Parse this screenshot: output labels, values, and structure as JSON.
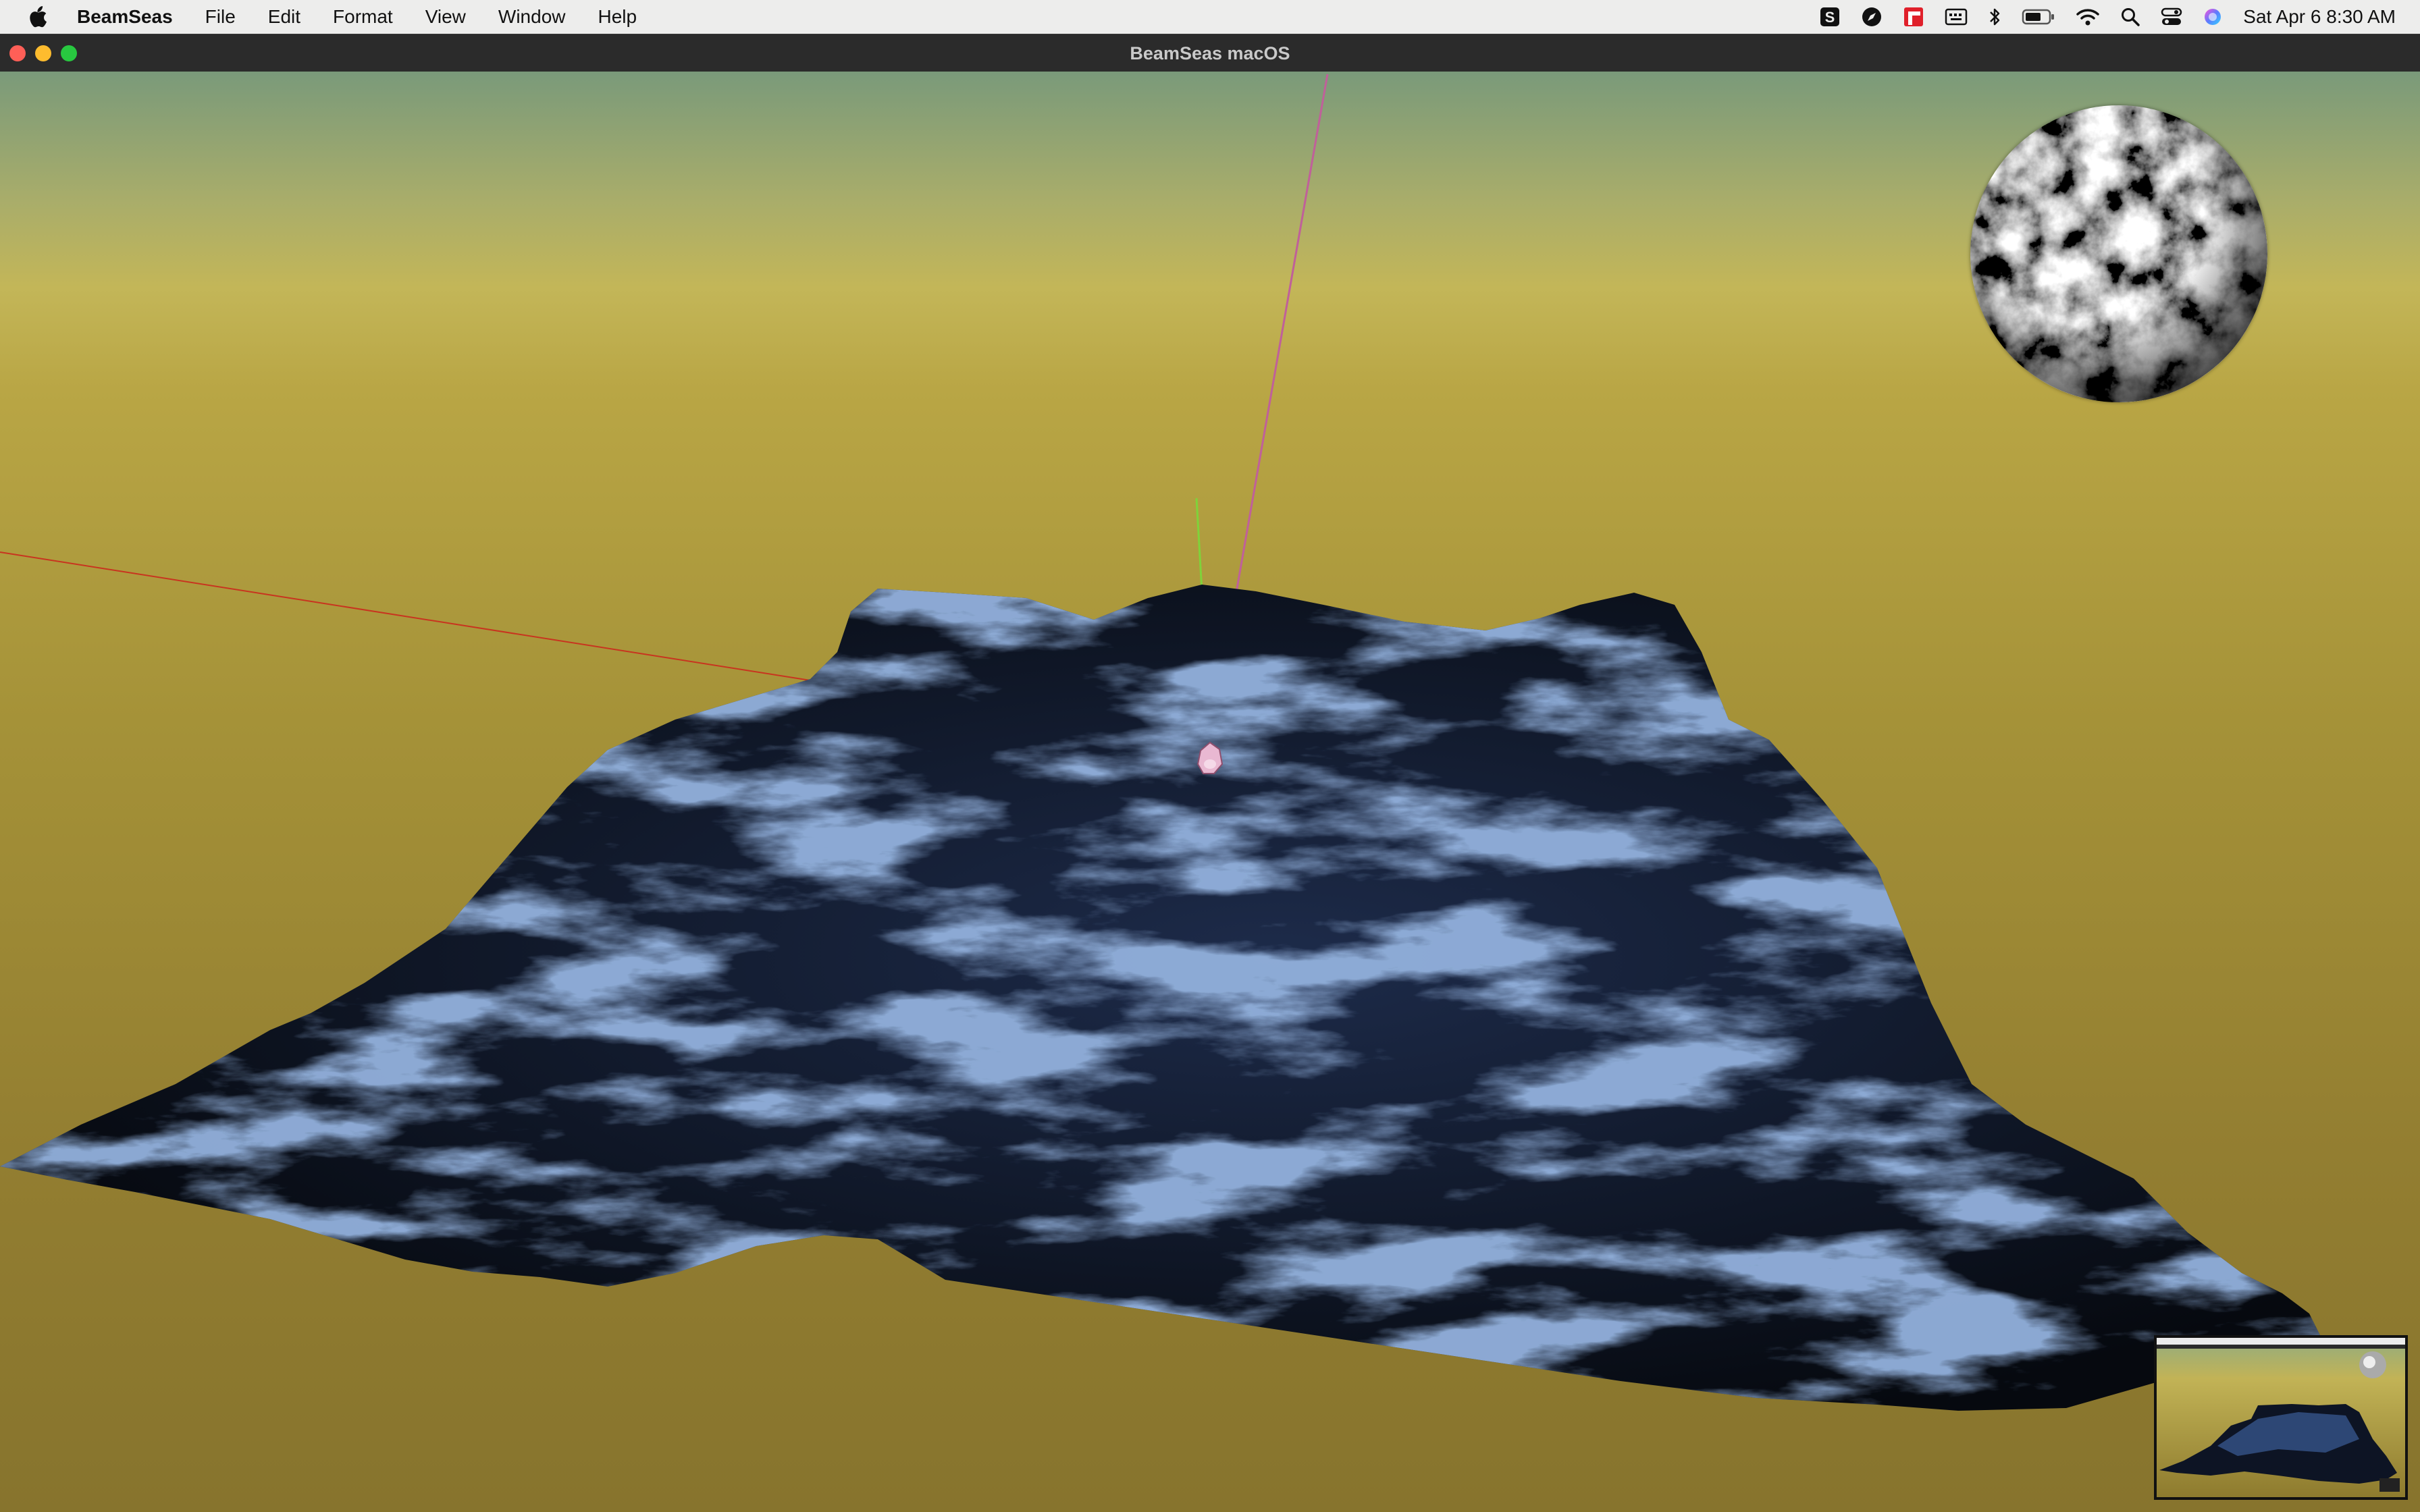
{
  "menubar": {
    "app_name": "BeamSeas",
    "items": [
      "File",
      "Edit",
      "Format",
      "View",
      "Window",
      "Help"
    ],
    "clock": "Sat Apr 6  8:30 AM"
  },
  "window": {
    "title": "BeamSeas macOS"
  },
  "colors": {
    "sky_top": "#7d9a78",
    "sky_horizon": "#c2b356",
    "ground": "#8c7a2c",
    "water_highlight": "#4a6fb0",
    "water_shadow": "#0a0f1a",
    "axis_x": "#d02a1c",
    "axis_y": "#7fd33a",
    "axis_z": "#c0609a"
  },
  "icons": [
    "apple-icon",
    "s-badge-icon",
    "compass-icon",
    "parallels-icon",
    "keyboard-icon",
    "bluetooth-icon",
    "battery-icon",
    "wifi-icon",
    "search-icon",
    "control-center-icon",
    "siri-icon"
  ]
}
